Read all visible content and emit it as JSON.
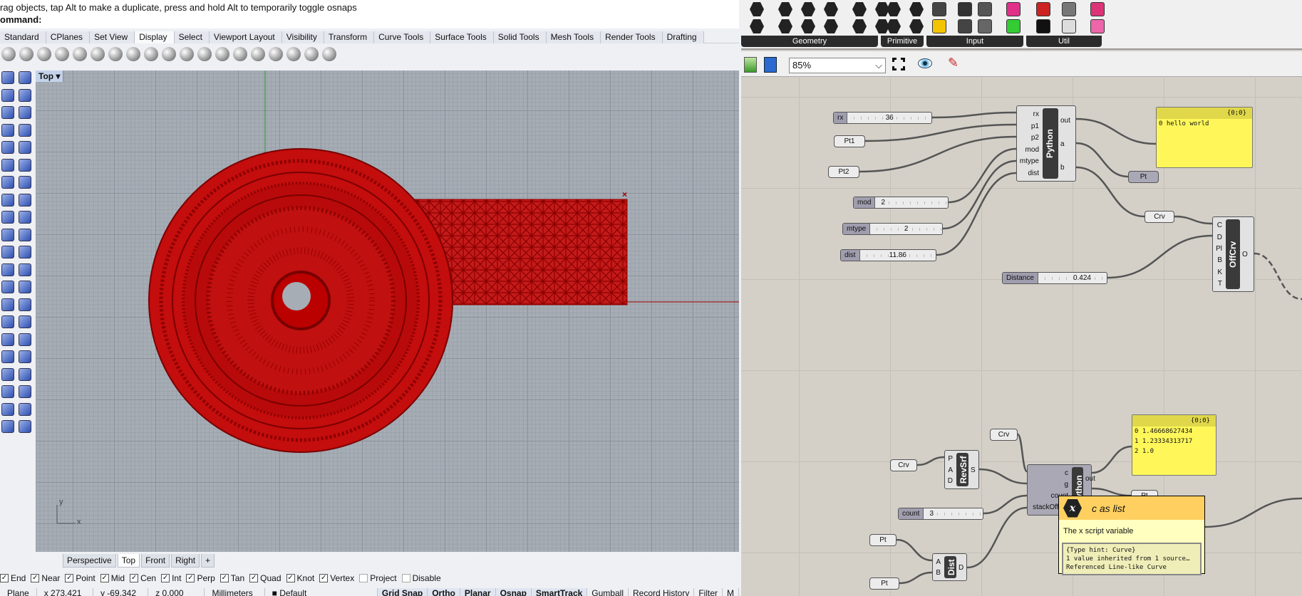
{
  "rhino": {
    "message": "rag objects, tap Alt to make a duplicate, press and hold Alt to temporarily toggle osnaps",
    "command_label": "ommand:",
    "tabs": [
      "Standard",
      "CPlanes",
      "Set View",
      "Display",
      "Select",
      "Viewport Layout",
      "Visibility",
      "Transform",
      "Curve Tools",
      "Surface Tools",
      "Solid Tools",
      "Mesh Tools",
      "Render Tools",
      "Drafting"
    ],
    "active_tab": "Display",
    "viewport_label": "Top",
    "viewport_tabs": [
      "Perspective",
      "Top",
      "Front",
      "Right",
      "+"
    ],
    "axis_y": "y",
    "axis_x": "x",
    "osnaps": [
      {
        "label": "End",
        "checked": true
      },
      {
        "label": "Near",
        "checked": true
      },
      {
        "label": "Point",
        "checked": true
      },
      {
        "label": "Mid",
        "checked": true
      },
      {
        "label": "Cen",
        "checked": true
      },
      {
        "label": "Int",
        "checked": true
      },
      {
        "label": "Perp",
        "checked": true
      },
      {
        "label": "Tan",
        "checked": true
      },
      {
        "label": "Quad",
        "checked": true
      },
      {
        "label": "Knot",
        "checked": true
      },
      {
        "label": "Vertex",
        "checked": true
      },
      {
        "label": "Project",
        "checked": false
      },
      {
        "label": "Disable",
        "checked": false
      }
    ],
    "status": {
      "plane": "Plane",
      "x": "x 273.421",
      "y": "y -69.342",
      "z": "z 0.000",
      "units": "Millimeters",
      "layer": "Default",
      "toggles": [
        "Grid Snap",
        "Ortho",
        "Planar",
        "Osnap",
        "SmartTrack",
        "Gumball",
        "Record History",
        "Filter",
        "M"
      ]
    },
    "colors": {
      "geometry": "#c00000",
      "grid": "#a6adb5"
    }
  },
  "grasshopper": {
    "ribbon_groups": [
      "Geometry",
      "Primitive",
      "Input",
      "Util"
    ],
    "zoom": "85%",
    "sliders": {
      "rx": {
        "label": "rx",
        "value": "36"
      },
      "mod": {
        "label": "mod",
        "value": "2"
      },
      "mtype": {
        "label": "mtype",
        "value": "2"
      },
      "dist": {
        "label": "dist",
        "value": "11.86"
      },
      "distance": {
        "label": "Distance",
        "value": "0.424"
      },
      "count": {
        "label": "count",
        "value": "3"
      }
    },
    "params": {
      "pt1": "Pt1",
      "pt2": "Pt2",
      "pt_out": "Pt",
      "crv_out": "Crv",
      "crv_top": "Crv",
      "crv_left": "Crv",
      "pt_a": "Pt",
      "pt_b": "Pt",
      "pt_hidden": "Pt"
    },
    "python1": {
      "name": "Python",
      "inputs": [
        "rx",
        "p1",
        "p2",
        "mod",
        "mtype",
        "dist"
      ],
      "outputs": [
        "out",
        "a",
        "b"
      ]
    },
    "panel1": {
      "path": "{0;0}",
      "rows": [
        {
          "i": "0",
          "v": "hello world"
        }
      ]
    },
    "offcrv": {
      "name": "OffCrv",
      "inputs": [
        "C",
        "D",
        "Pl",
        "B",
        "K",
        "T"
      ],
      "outputs": [
        "O"
      ]
    },
    "revsrf": {
      "name": "RevSrf",
      "inputs": [
        "P",
        "A",
        "D"
      ],
      "outputs": [
        "S"
      ]
    },
    "python2": {
      "name": "Python",
      "inputs": [
        "c",
        "g",
        "count",
        "stackOffset"
      ],
      "outputs": [
        "out",
        "b"
      ]
    },
    "panel2": {
      "path": "{0;0}",
      "rows": [
        {
          "i": "0",
          "v": "1.46668627434"
        },
        {
          "i": "1",
          "v": "1.23334313717"
        },
        {
          "i": "2",
          "v": "1.0"
        }
      ]
    },
    "dist": {
      "name": "Dist",
      "inputs": [
        "A",
        "B"
      ],
      "outputs": [
        "D"
      ]
    },
    "tooltip": {
      "title": "c as list",
      "icon": "x",
      "description": "The x script variable",
      "details": [
        "{Type hint: Curve}",
        "1 value inherited from 1 source…",
        "Referenced Line-like Curve"
      ]
    }
  }
}
